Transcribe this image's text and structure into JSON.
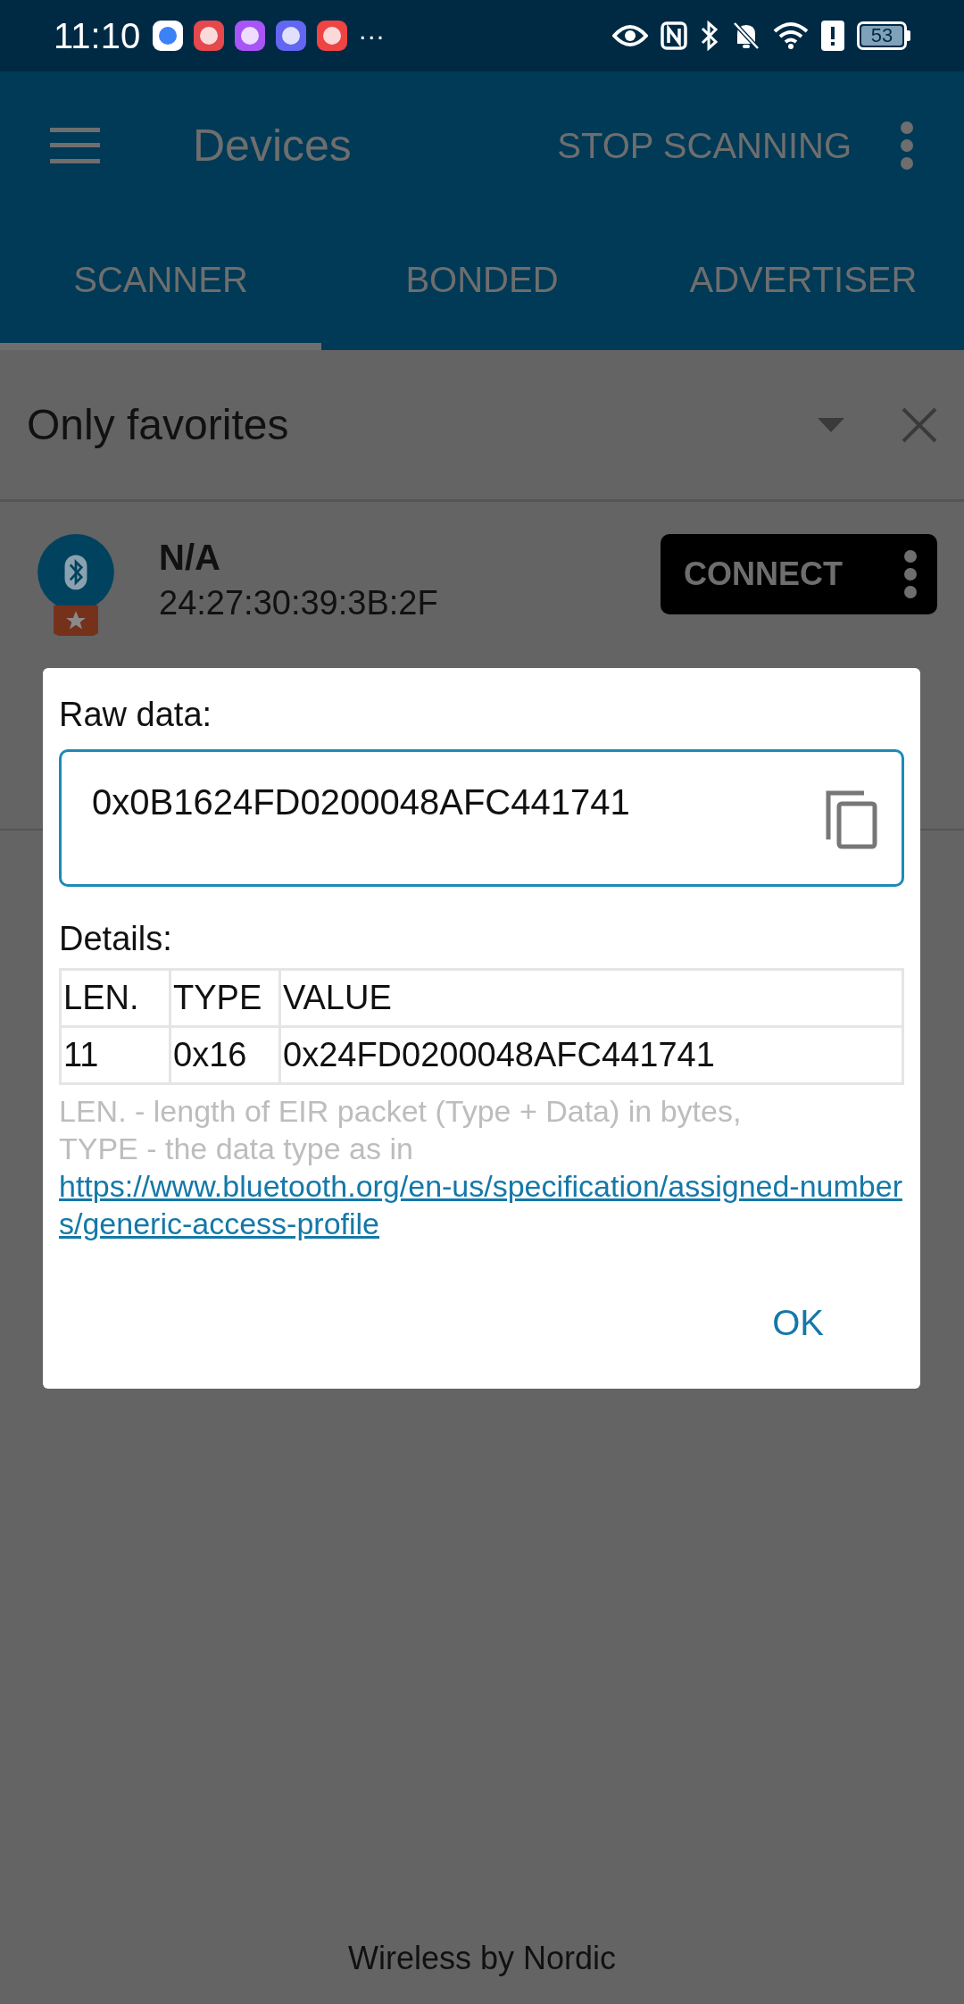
{
  "status_bar": {
    "time": "11:10",
    "more": "···",
    "battery": "53"
  },
  "app_bar": {
    "title": "Devices",
    "action": "STOP SCANNING"
  },
  "tabs": [
    {
      "label": "SCANNER",
      "selected": true
    },
    {
      "label": "BONDED",
      "selected": false
    },
    {
      "label": "ADVERTISER",
      "selected": false
    }
  ],
  "filter": {
    "value": "Only favorites"
  },
  "device": {
    "name": "N/A",
    "address": "24:27:30:39:3B:2F",
    "action": "CONNECT"
  },
  "dialog": {
    "raw_label": "Raw data:",
    "raw_value": "0x0B1624FD0200048AFC441741",
    "details_label": "Details:",
    "columns": [
      "LEN.",
      "TYPE",
      "VALUE"
    ],
    "rows": [
      [
        "11",
        "0x16",
        "0x24FD0200048AFC441741"
      ]
    ],
    "note_lines": [
      "LEN. - length of EIR packet (Type + Data) in bytes,",
      "TYPE - the data type as in"
    ],
    "link": "https://www.bluetooth.org/en-us/specification/assigned-numbers/generic-access-profile",
    "ok": "OK"
  },
  "footer": "Wireless by Nordic"
}
